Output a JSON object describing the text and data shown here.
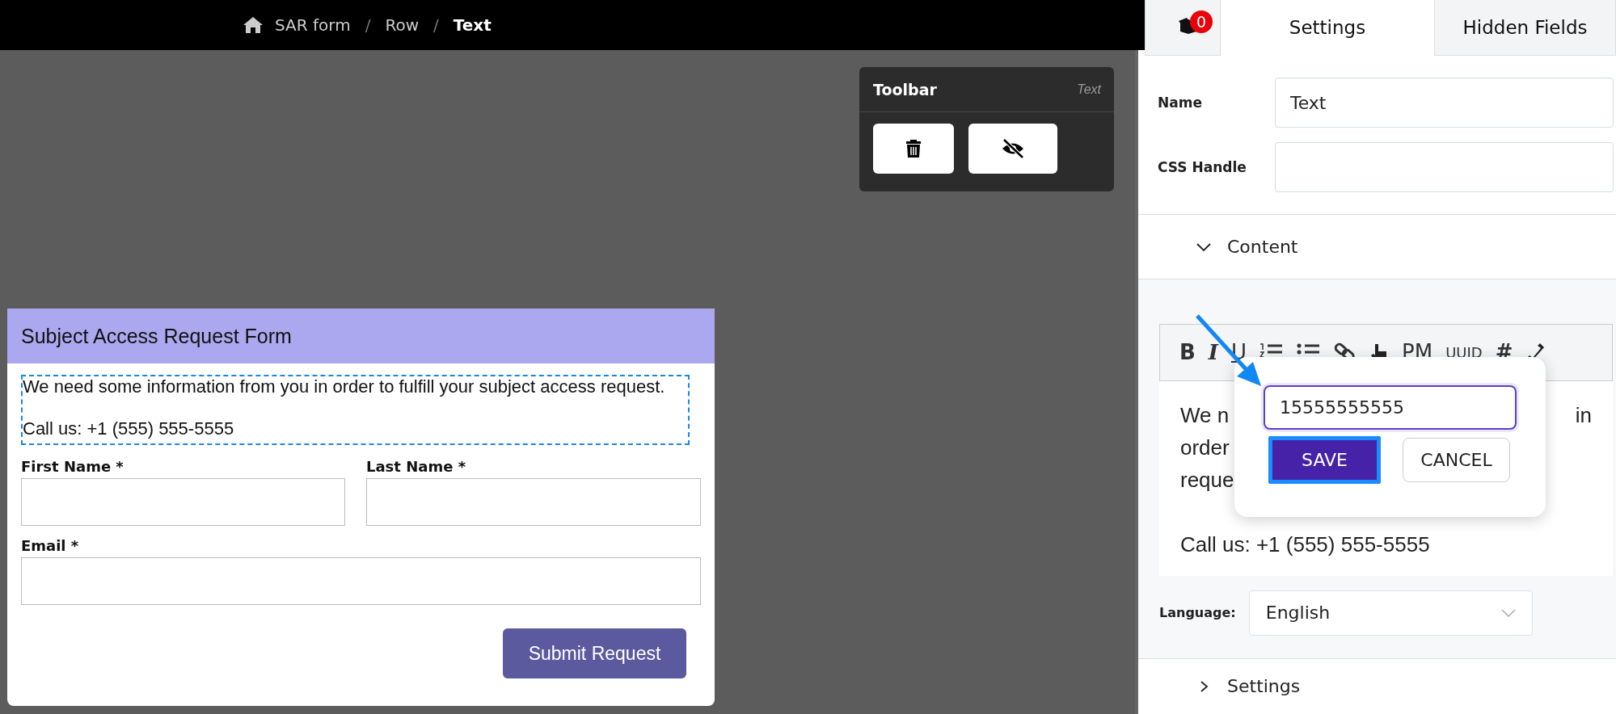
{
  "breadcrumb": [
    {
      "kind": "crumb",
      "label": "SAR form",
      "current": false
    },
    {
      "kind": "separator",
      "label": "/"
    },
    {
      "kind": "crumb",
      "label": "Row",
      "current": false
    },
    {
      "kind": "separator",
      "label": "/"
    },
    {
      "kind": "crumb",
      "label": "Text",
      "current": true
    }
  ],
  "toolbar": {
    "title": "Toolbar",
    "element_type": "Text"
  },
  "form": {
    "title": "Subject Access Request Form",
    "intro": [
      "We need some information from you in order to fulfill your subject access request.",
      "Call us: +1 (555) 555-5555"
    ],
    "fields": [
      {
        "label": "First Name *",
        "kind": "half"
      },
      {
        "label": "Last Name *",
        "kind": "half"
      },
      {
        "label": "Email *",
        "kind": "full"
      }
    ],
    "submit": "Submit Request"
  },
  "panel": {
    "tabs": [
      {
        "kind": "icon",
        "badge": "0",
        "selected": false
      },
      {
        "kind": "text",
        "label": "Settings",
        "selected": true
      },
      {
        "kind": "text",
        "label": "Hidden Fields",
        "selected": false
      }
    ],
    "name": {
      "label": "Name",
      "value": "Text"
    },
    "css_handle": {
      "label": "CSS Handle"
    },
    "content_section": {
      "label": "Content",
      "expanded": true
    },
    "editor_tools": [
      {
        "kind": "text",
        "label": "B"
      },
      {
        "kind": "text",
        "label": "I"
      },
      {
        "kind": "text",
        "label": "U"
      },
      {
        "kind": "icon"
      },
      {
        "kind": "icon"
      },
      {
        "kind": "icon"
      },
      {
        "kind": "icon"
      },
      {
        "kind": "text",
        "label": "PM"
      },
      {
        "kind": "text",
        "label": "UUID"
      },
      {
        "kind": "text",
        "label": "#"
      },
      {
        "kind": "icon"
      }
    ],
    "editor": {
      "visible_lines": [
        {
          "text": "We n",
          "end_text": "in"
        },
        {
          "text": "order"
        },
        {
          "text": "reque"
        }
      ],
      "closing_line": "Call us: +1 (555) 555-5555"
    },
    "popup": {
      "value": "15555555555",
      "save": "SAVE",
      "cancel": "CANCEL",
      "save_focused": true
    },
    "language": {
      "label": "Language:",
      "value": "English"
    },
    "settings_section": {
      "label": "Settings",
      "expanded": false
    }
  }
}
